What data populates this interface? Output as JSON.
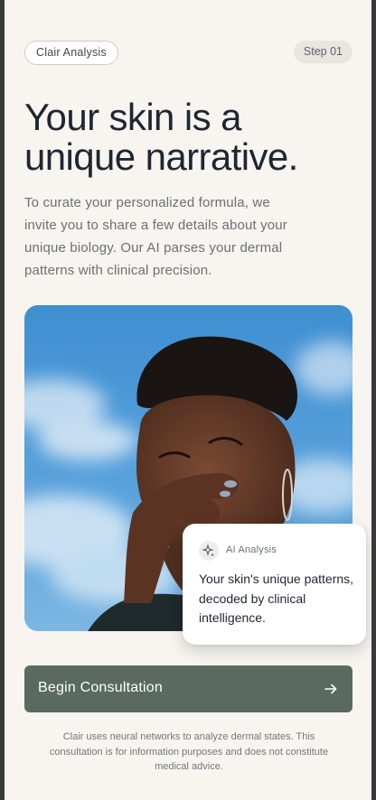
{
  "header": {
    "brand_pill": "Clair Analysis",
    "step": "Step 01"
  },
  "hero": {
    "headline_line1": "Your skin is a",
    "headline_line2": "unique narrative.",
    "intro": "To curate your personalized formula, we invite you to share a few details about your unique biology. Our AI parses your dermal patterns with clinical precision."
  },
  "ai_card": {
    "icon": "sparkle-icon",
    "label": "AI Analysis",
    "text": "Your skin's unique patterns, decoded by clinical intelligence."
  },
  "cta": {
    "label": "Begin Consultation",
    "icon": "arrow-right-icon"
  },
  "footer": {
    "disclaimer": "Clair uses neural networks to analyze dermal states. This consultation is for information purposes and does not constitute medical advice."
  },
  "colors": {
    "background": "#f8f5f0",
    "text_dark": "#1f2633",
    "text_muted": "#6b6f76",
    "cta_background": "#5a6a60",
    "sky_blue": "#4f9bd6"
  }
}
